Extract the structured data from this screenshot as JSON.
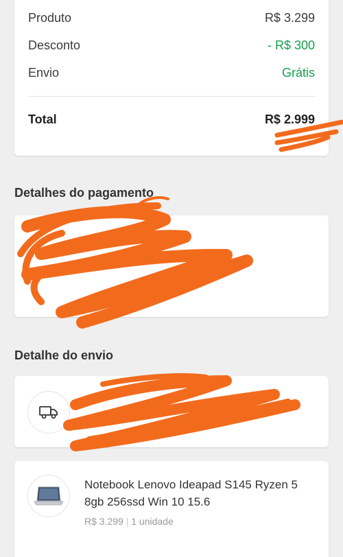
{
  "summary": {
    "rows": [
      {
        "label": "Produto",
        "value": "R$ 3.299"
      },
      {
        "label": "Desconto",
        "value": "- R$ 300"
      },
      {
        "label": "Envio",
        "value": "Grátis"
      }
    ],
    "total_label": "Total",
    "total_value": "R$ 2.999"
  },
  "payment": {
    "title": "Detalhes do pagamento"
  },
  "shipping": {
    "title": "Detalhe do envio",
    "icon": "truck-icon"
  },
  "product": {
    "name": "Notebook Lenovo Ideapad S145 Ryzen 5 8gb 256ssd Win 10 15.6",
    "price": "R$ 3.299",
    "quantity": "1 unidade",
    "separator": "|"
  },
  "colors": {
    "accent_green": "#14a04c",
    "redaction_orange": "#f26b1d"
  }
}
